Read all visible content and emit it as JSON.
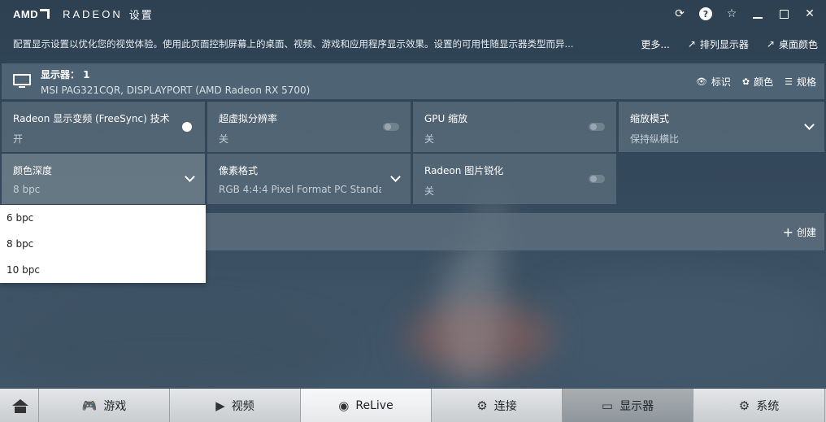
{
  "titlebar": {
    "brand": "AMD",
    "product": "RADEON",
    "section": "设置"
  },
  "description": {
    "text": "配置显示设置以优化您的视觉体验。使用此页面控制屏幕上的桌面、视频、游戏和应用程序显示效果。设置的可用性随显示器类型而异...",
    "more": "更多...",
    "arrange_label": "排列显示器",
    "desktop_color_label": "桌面颜色"
  },
  "display": {
    "title": "显示器： 1",
    "subtitle": "MSI PAG321CQR, DISPLAYPORT (AMD Radeon RX 5700)",
    "identify_label": "标识",
    "color_label": "颜色",
    "specs_label": "规格"
  },
  "tiles": [
    {
      "title": "Radeon 显示变频 (FreeSync) 技术",
      "value": "开",
      "control": "toggle",
      "state": "on"
    },
    {
      "title": "超虚拟分辨率",
      "value": "关",
      "control": "toggle",
      "state": "off"
    },
    {
      "title": "GPU 缩放",
      "value": "关",
      "control": "toggle",
      "state": "off"
    },
    {
      "title": "缩放模式",
      "value": "保持纵横比",
      "control": "dropdown"
    },
    {
      "title": "颜色深度",
      "value": "8 bpc",
      "control": "dropdown"
    },
    {
      "title": "像素格式",
      "value": "RGB 4:4:4 Pixel Format PC Standa...",
      "control": "dropdown"
    },
    {
      "title": "Radeon 图片锐化",
      "value": "关",
      "control": "toggle",
      "state": "off"
    }
  ],
  "custom": {
    "create_label": "创建"
  },
  "dropdown": {
    "options": [
      "6 bpc",
      "8 bpc",
      "10 bpc"
    ],
    "selected": "8 bpc"
  },
  "nav": {
    "items": [
      "游戏",
      "视频",
      "ReLive",
      "连接",
      "显示器",
      "系统"
    ],
    "active": "ReLive",
    "selected": "显示器"
  },
  "icons": {
    "restore": "refresh-icon",
    "help": "help-icon",
    "favorite": "star-icon"
  }
}
